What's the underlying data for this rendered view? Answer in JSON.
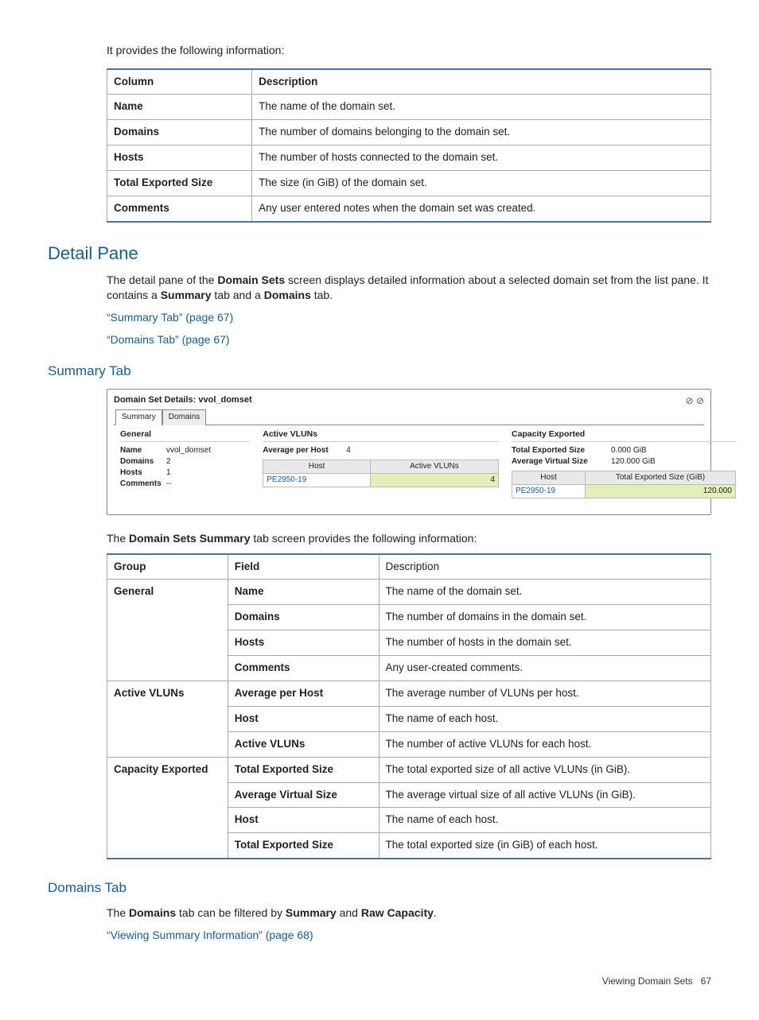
{
  "intro_line": "It provides the following information:",
  "table1": {
    "headers": {
      "col": "Column",
      "desc": "Description"
    },
    "rows": [
      {
        "col": "Name",
        "desc": "The name of the domain set."
      },
      {
        "col": "Domains",
        "desc": "The number of domains belonging to the domain set."
      },
      {
        "col": "Hosts",
        "desc": "The number of hosts connected to the domain set."
      },
      {
        "col": "Total Exported Size",
        "desc": "The size (in GiB) of the domain set."
      },
      {
        "col": "Comments",
        "desc": "Any user entered notes when the domain set was created."
      }
    ]
  },
  "detail_pane": {
    "heading": "Detail Pane",
    "para_parts": [
      "The detail pane of the ",
      "Domain Sets",
      " screen displays detailed information about a selected domain set from the list pane. It contains a ",
      "Summary",
      " tab and a ",
      "Domains",
      " tab."
    ],
    "links": [
      "“Summary Tab” (page 67)",
      "“Domains Tab” (page 67)"
    ]
  },
  "summary_tab_heading": "Summary Tab",
  "shot": {
    "title": "Domain Set Details: vvol_domset",
    "tabs": {
      "summary": "Summary",
      "domains": "Domains"
    },
    "general": {
      "title": "General",
      "name_k": "Name",
      "name_v": "vvol_domset",
      "domains_k": "Domains",
      "domains_v": "2",
      "hosts_k": "Hosts",
      "hosts_v": "1",
      "comments_k": "Comments",
      "comments_v": "--"
    },
    "active": {
      "title": "Active VLUNs",
      "avg_k": "Average per Host",
      "avg_v": "4",
      "th_host": "Host",
      "th_vluns": "Active VLUNs",
      "td_host": "PE2950-19",
      "td_vluns": "4"
    },
    "cap": {
      "title": "Capacity Exported",
      "tes_k": "Total Exported Size",
      "tes_v": "0.000 GiB",
      "avs_k": "Average Virtual Size",
      "avs_v": "120.000 GiB",
      "th_host": "Host",
      "th_size": "Total Exported Size (GiB)",
      "td_host": "PE2950-19",
      "td_size": "120.000"
    }
  },
  "summary_intro_parts": [
    "The ",
    "Domain Sets Summary",
    " tab screen provides the following information:"
  ],
  "table2": {
    "headers": {
      "group": "Group",
      "field": "Field",
      "desc": "Description"
    },
    "groups": [
      {
        "group": "General",
        "rows": [
          {
            "field": "Name",
            "desc": "The name of the domain set."
          },
          {
            "field": "Domains",
            "desc": "The number of domains in the domain set."
          },
          {
            "field": "Hosts",
            "desc": "The number of hosts in the domain set."
          },
          {
            "field": "Comments",
            "desc": "Any user-created comments."
          }
        ]
      },
      {
        "group": "Active VLUNs",
        "rows": [
          {
            "field": "Average per Host",
            "desc": "The average number of VLUNs per host."
          },
          {
            "field": "Host",
            "desc": "The name of each host."
          },
          {
            "field": "Active VLUNs",
            "desc": "The number of active VLUNs for each host."
          }
        ]
      },
      {
        "group": "Capacity Exported",
        "rows": [
          {
            "field": "Total Exported Size",
            "desc": "The total exported size of all active VLUNs (in GiB)."
          },
          {
            "field": "Average Virtual Size",
            "desc": "The average virtual size of all active VLUNs (in GiB)."
          },
          {
            "field": "Host",
            "desc": "The name of each host."
          },
          {
            "field": "Total Exported Size",
            "desc": "The total exported size (in GiB) of each host."
          }
        ]
      }
    ]
  },
  "domains_tab": {
    "heading": "Domains Tab",
    "para_parts": [
      "The ",
      "Domains",
      " tab can be filtered by ",
      "Summary",
      " and ",
      "Raw Capacity",
      "."
    ],
    "link": "“Viewing Summary Information” (page 68)"
  },
  "footer": {
    "label": "Viewing Domain Sets",
    "page": "67"
  }
}
